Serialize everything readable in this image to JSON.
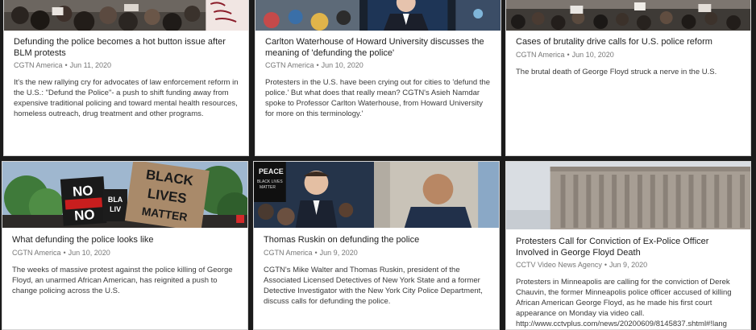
{
  "cards": [
    {
      "title": "Defunding the police becomes a hot button issue after BLM protests",
      "source": "CGTN America",
      "date": "Jun 11, 2020",
      "description": "It's the new rallying cry for advocates of law enforcement reform in the U.S.: \"Defund the Police\"- a push to shift funding away from expensive traditional policing and toward mental health resources, homeless outreach, drug treatment and other programs."
    },
    {
      "title": "Carlton Waterhouse of Howard University discusses the meaning of 'defunding the police'",
      "source": "CGTN America",
      "date": "Jun 10, 2020",
      "description": "Protesters in the U.S. have been crying out for cities to 'defund the police.' But what does that really mean? CGTN's Asieh Namdar spoke to Professor Carlton Waterhouse, from Howard University for more on this terminology.'"
    },
    {
      "title": "Cases of brutality drive calls for U.S. police reform",
      "source": "CGTN America",
      "date": "Jun 10, 2020",
      "description": "The brutal death of George Floyd struck a nerve in the U.S."
    },
    {
      "title": "What defunding the police looks like",
      "source": "CGTN America",
      "date": "Jun 10, 2020",
      "description": "The weeks of massive protest against the police killing of George Floyd, an unarmed African American, has reignited a push to change policing across the U.S.",
      "image_text": {
        "sign_no_top": "NO",
        "sign_no_bottom": "NO",
        "sign_black": "BLACK",
        "sign_lives": "LIVES",
        "sign_matter": "MATTER",
        "sign_bla": "BLA",
        "sign_liv": "LIV"
      }
    },
    {
      "title": "Thomas Ruskin on defunding the police",
      "source": "CGTN America",
      "date": "Jun 9, 2020",
      "description": "CGTN's Mike Walter and Thomas Ruskin, president of the Associated Licensed Detectives of New York State and a former Detective Investigator with the New York City Police Department, discuss calls for defunding the police.",
      "image_text": {
        "peace": "PEACE",
        "sign_line2": "BLACK LIVES",
        "sign_line3": "MATTER"
      }
    },
    {
      "title": "Protesters Call for Conviction of Ex-Police Officer Involved in George Floyd Death",
      "source": "CCTV Video News Agency",
      "date": "Jun 9, 2020",
      "description": "Protesters in Minneapolis are calling for the conviction of Derek Chauvin, the former Minneapolis police officer accused of killing African American George Floyd, as he made his first court appearance on Monday via video call.",
      "url": "http://www.cctvplus.com/news/20200609/8145837.shtml#!lang"
    }
  ],
  "colors": {
    "background": "#1b1b1b",
    "card_background": "#ffffff",
    "title_text": "#222222",
    "meta_text": "#777777",
    "description_text": "#3a3a3a"
  }
}
